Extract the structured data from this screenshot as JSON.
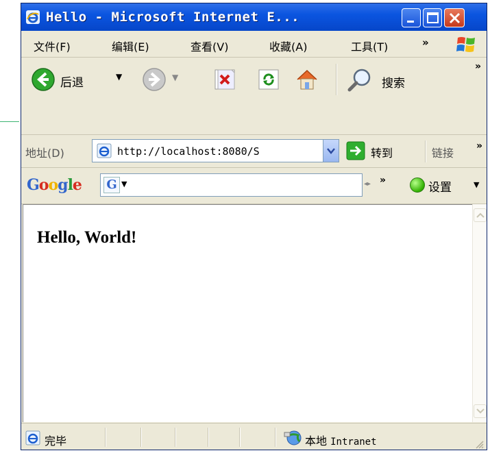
{
  "window": {
    "title": "Hello - Microsoft Internet E...",
    "controls": [
      "minimize",
      "maximize",
      "close"
    ]
  },
  "menu": {
    "items": [
      "文件(F)",
      "编辑(E)",
      "查看(V)",
      "收藏(A)",
      "工具(T)"
    ],
    "more": "»"
  },
  "toolbar": {
    "back_label": "后退",
    "search_label": "搜索",
    "more": "»"
  },
  "address": {
    "label": "地址(D)",
    "url": "http://localhost:8080/S",
    "go_label": "转到",
    "links_label": "链接",
    "more": "»"
  },
  "google": {
    "logo": "Google",
    "more": "»",
    "settings_label": "设置"
  },
  "page": {
    "heading": "Hello, World!"
  },
  "status": {
    "text": "完毕",
    "zone_cn": "本地",
    "zone_en": "Intranet"
  },
  "colors": {
    "titlebar": "#0b55e0",
    "chrome": "#ece9d8",
    "google_blue": "#3366cc"
  }
}
